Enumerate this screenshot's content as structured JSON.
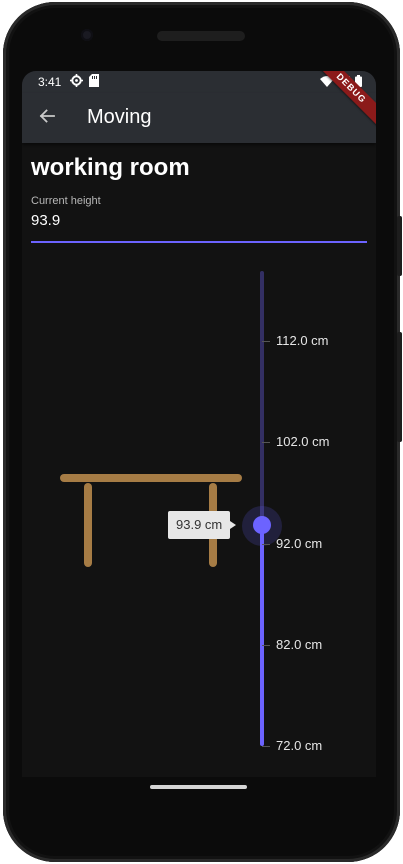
{
  "status_bar": {
    "time": "3:41",
    "left_icons": [
      "gear-icon",
      "sd-card-icon"
    ],
    "right_icons": [
      "wifi-icon",
      "signal-icon",
      "battery-icon"
    ]
  },
  "app_bar": {
    "title": "Moving",
    "back_icon": "arrow-back-icon",
    "debug_banner": "DEBUG"
  },
  "room": {
    "name": "working room"
  },
  "height_field": {
    "label": "Current height",
    "value": "93.9"
  },
  "slider": {
    "min": 72.0,
    "max": 112.0,
    "value": 93.9,
    "tooltip": "93.9 cm",
    "tick_labels": [
      "112.0 cm",
      "102.0 cm",
      "92.0 cm",
      "82.0 cm",
      "72.0 cm"
    ],
    "active_color": "#6c63ff",
    "inactive_color": "#332f63"
  },
  "desk": {
    "color": "#a67c45"
  }
}
